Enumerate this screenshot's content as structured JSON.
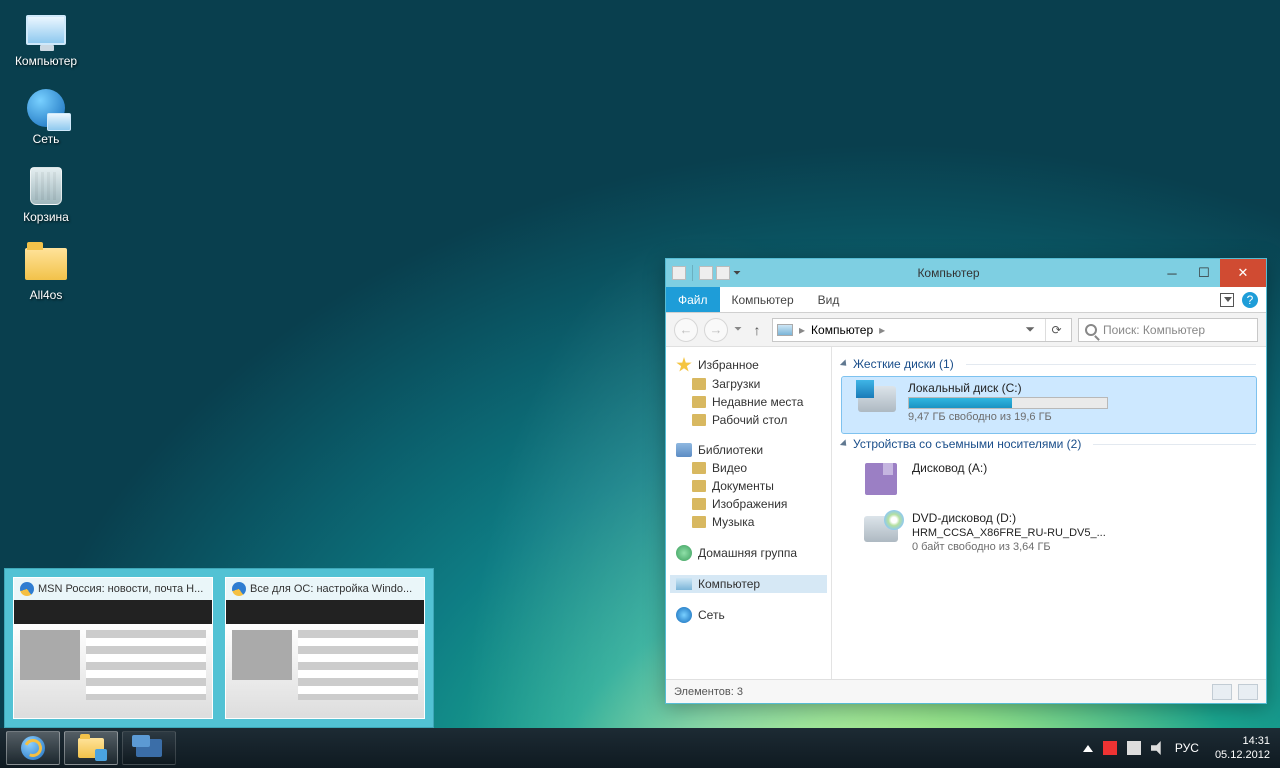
{
  "desktop_icons": {
    "computer": "Компьютер",
    "network": "Сеть",
    "recycle": "Корзина",
    "folder1": "All4os"
  },
  "previews": {
    "tab1": "MSN Россия: новости, почта H...",
    "tab2": "Все для ОС: настройка Windo..."
  },
  "taskbar": {
    "lang": "РУС",
    "time": "14:31",
    "date": "05.12.2012"
  },
  "explorer": {
    "title": "Компьютер",
    "qa_dropdown": "⏷",
    "tabs": {
      "file": "Файл",
      "computer": "Компьютер",
      "view": "Вид"
    },
    "help": "?",
    "nav": {
      "back": "←",
      "forward": "→",
      "up": "↑",
      "path_root": "Компьютер",
      "refresh": "⟳"
    },
    "search_placeholder": "Поиск: Компьютер",
    "navpane": {
      "favorites": "Избранное",
      "fav_items": {
        "downloads": "Загрузки",
        "recent": "Недавние места",
        "desktop": "Рабочий стол"
      },
      "libraries": "Библиотеки",
      "lib_items": {
        "video": "Видео",
        "documents": "Документы",
        "pictures": "Изображения",
        "music": "Музыка"
      },
      "homegroup": "Домашняя группа",
      "computer": "Компьютер",
      "network": "Сеть"
    },
    "content": {
      "cat_hdd": "Жесткие диски (1)",
      "c_title": "Локальный диск (C:)",
      "c_sub": "9,47 ГБ свободно из 19,6 ГБ",
      "c_fill_pct": 52,
      "cat_removable": "Устройства со съемными носителями (2)",
      "a_title": "Дисковод (A:)",
      "d_title": "DVD-дисковод (D:)",
      "d_line2": "HRM_CCSA_X86FRE_RU-RU_DV5_...",
      "d_sub": "0 байт свободно из 3,64 ГБ"
    },
    "status": {
      "items": "Элементов: 3"
    }
  }
}
